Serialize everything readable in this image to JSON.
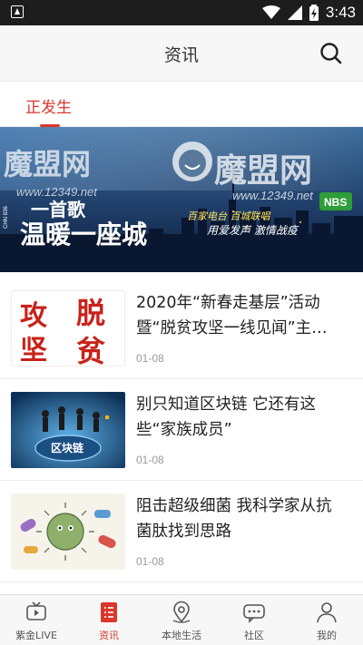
{
  "status_bar": {
    "time": "3:43"
  },
  "header": {
    "title": "资讯"
  },
  "tabs": [
    {
      "label": "正发生"
    }
  ],
  "banner": {
    "watermark_text": "魔盟网",
    "watermark_url": "www.12349.net",
    "song_line1": "一首歌",
    "song_line2": "温暖一座城",
    "tagline1": "百家电台 百城联唱",
    "tagline2": "用爱发声 激情战疫",
    "side_text": "CHN 836",
    "badge": "NBS"
  },
  "news": [
    {
      "title": "2020年“新春走基层”活动暨“脱贫攻坚一线见闻”主…",
      "date": "01-08",
      "thumb_text": [
        "攻",
        "脱",
        "坚",
        "贫"
      ]
    },
    {
      "title": "别只知道区块链 它还有这些“家族成员”",
      "date": "01-08",
      "thumb_text": [
        "区块链"
      ]
    },
    {
      "title": "阻击超级细菌 我科学家从抗菌肽找到思路",
      "date": "01-08",
      "thumb_text": []
    }
  ],
  "bottom_nav": [
    {
      "label": "紫金LIVE",
      "icon": "tv-play-icon",
      "active": false
    },
    {
      "label": "资讯",
      "icon": "news-list-icon",
      "active": true
    },
    {
      "label": "本地生活",
      "icon": "location-pin-icon",
      "active": false
    },
    {
      "label": "社区",
      "icon": "chat-bubble-icon",
      "active": false
    },
    {
      "label": "我的",
      "icon": "person-icon",
      "active": false
    }
  ],
  "colors": {
    "accent": "#d9372c",
    "header_bg": "#f7f7f7",
    "status_bg": "#1d1d1d"
  }
}
